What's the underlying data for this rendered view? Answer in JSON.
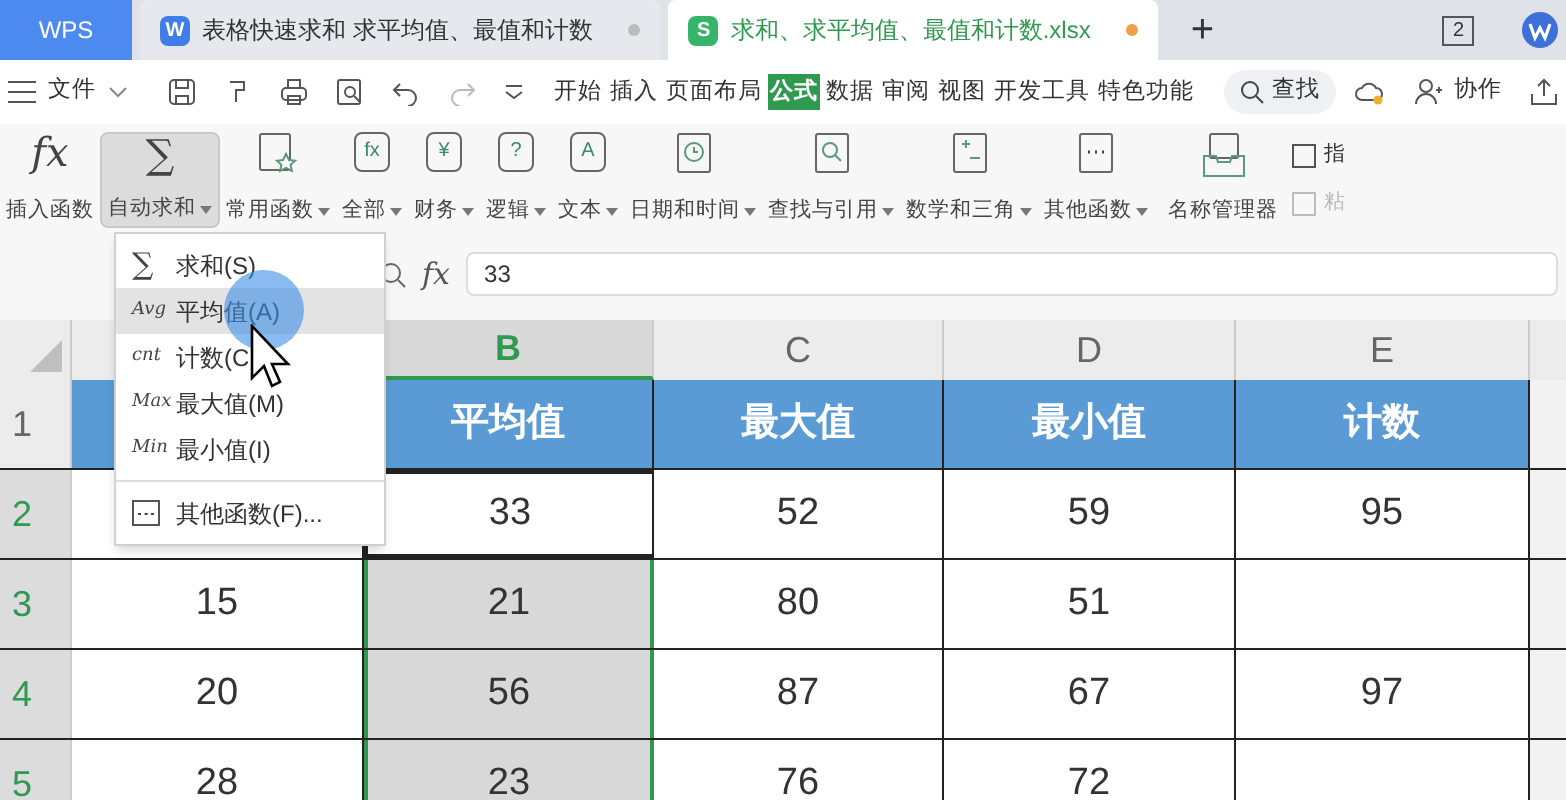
{
  "app_tabs": [
    {
      "kind": "home",
      "label": "WPS",
      "selected": false
    },
    {
      "kind": "writer",
      "icon": "W",
      "label": "表格快速求和 求平均值、最值和计数",
      "selected": false
    },
    {
      "kind": "sheet",
      "icon": "S",
      "label": "求和、求平均值、最值和计数.xlsx",
      "selected": true
    }
  ],
  "new_tab": "+",
  "window_count": "2",
  "menu": {
    "file": "文件",
    "tabs": [
      {
        "label": "开始",
        "selected": false
      },
      {
        "label": "插入",
        "selected": false
      },
      {
        "label": "页面布局",
        "selected": false
      },
      {
        "label": "公式",
        "selected": true
      },
      {
        "label": "数据",
        "selected": false
      },
      {
        "label": "审阅",
        "selected": false
      },
      {
        "label": "视图",
        "selected": false
      },
      {
        "label": "开发工具",
        "selected": false
      },
      {
        "label": "特色功能",
        "selected": false
      }
    ],
    "search": "查找",
    "collab": "协作"
  },
  "ribbon": {
    "items": [
      {
        "label": "插入函数",
        "kind": "big",
        "glyph": "fx",
        "dropdown": false,
        "selected": false
      },
      {
        "label": "自动求和",
        "kind": "big",
        "glyph": "∑",
        "dropdown": true,
        "selected": true
      },
      {
        "label": "常用函数",
        "kind": "star",
        "dropdown": true,
        "selected": false
      },
      {
        "label": "全部",
        "kind": "box",
        "glyph": "fx",
        "dropdown": true,
        "selected": false
      },
      {
        "label": "财务",
        "kind": "box",
        "glyph": "¥",
        "dropdown": true,
        "selected": false
      },
      {
        "label": "逻辑",
        "kind": "box",
        "glyph": "?",
        "dropdown": true,
        "selected": false
      },
      {
        "label": "文本",
        "kind": "box",
        "glyph": "A",
        "dropdown": true,
        "selected": false
      },
      {
        "label": "日期和时间",
        "kind": "clock",
        "dropdown": true,
        "selected": false
      },
      {
        "label": "查找与引用",
        "kind": "lookup",
        "dropdown": true,
        "selected": false
      },
      {
        "label": "数学和三角",
        "kind": "math",
        "dropdown": true,
        "selected": false
      },
      {
        "label": "其他函数",
        "kind": "more",
        "dropdown": true,
        "selected": false
      },
      {
        "label": "名称管理器",
        "kind": "tray",
        "dropdown": false,
        "selected": false
      }
    ],
    "side": [
      {
        "label": "指",
        "disabled": false
      },
      {
        "label": "粘",
        "disabled": true
      }
    ]
  },
  "formula_bar": {
    "glyph": "fx",
    "value": "33"
  },
  "dropdown": [
    {
      "kind": "text",
      "icon": "∑",
      "label": "求和(S)",
      "selected": false
    },
    {
      "kind": "text",
      "icon": "Avg",
      "label": "平均值(A)",
      "selected": true
    },
    {
      "kind": "text",
      "icon": "cnt",
      "label": "计数(C",
      "selected": false
    },
    {
      "kind": "text",
      "icon": "Max",
      "label": "最大值(M)",
      "selected": false
    },
    {
      "kind": "text",
      "icon": "Min",
      "label": "最小值(I)",
      "selected": false
    },
    {
      "kind": "more",
      "label": "其他函数(F)...",
      "selected": false
    }
  ],
  "sheet": {
    "columns": [
      null,
      {
        "label": "B",
        "selected": true
      },
      {
        "label": "C",
        "selected": false
      },
      {
        "label": "D",
        "selected": false
      },
      {
        "label": "E",
        "selected": false
      }
    ],
    "rows": [
      {
        "number": "1",
        "kind": "header",
        "selected": false,
        "cells": [
          null,
          "平均值",
          "最大值",
          "最小值",
          "计数"
        ]
      },
      {
        "number": "2",
        "kind": "data",
        "selected": true,
        "cells": [
          null,
          "33",
          "52",
          "59",
          "95"
        ]
      },
      {
        "number": "3",
        "kind": "data",
        "selected": true,
        "cells": [
          "15",
          "21",
          "80",
          "51",
          null
        ]
      },
      {
        "number": "4",
        "kind": "data",
        "selected": true,
        "cells": [
          "20",
          "56",
          "87",
          "67",
          "97"
        ]
      },
      {
        "number": "5",
        "kind": "data",
        "selected": true,
        "cells": [
          "28",
          "23",
          "76",
          "72",
          null
        ]
      }
    ]
  }
}
